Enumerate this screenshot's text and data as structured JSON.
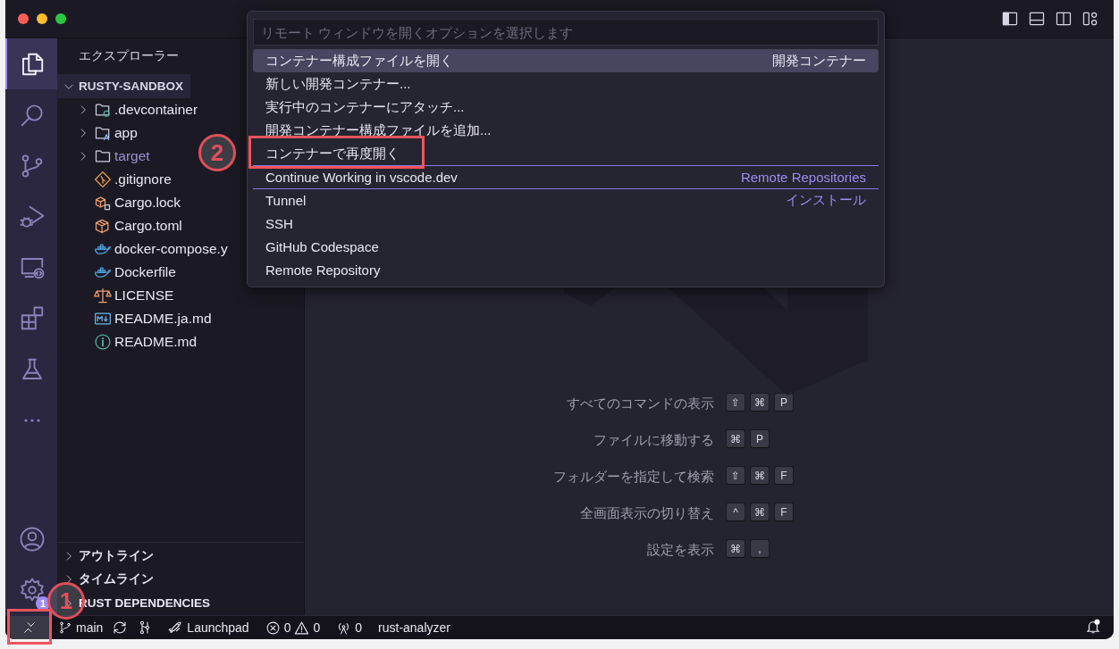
{
  "activity_bar": {
    "top": [
      {
        "kind": "files",
        "selected": true
      },
      {
        "kind": "search",
        "selected": false
      },
      {
        "kind": "source-control",
        "selected": false
      },
      {
        "kind": "run-debug",
        "selected": false
      },
      {
        "kind": "remote",
        "selected": false
      },
      {
        "kind": "extensions",
        "selected": false
      },
      {
        "kind": "testing",
        "selected": false
      },
      {
        "kind": "more",
        "selected": false
      }
    ],
    "bottom": [
      {
        "kind": "account",
        "selected": false
      },
      {
        "kind": "settings",
        "selected": false,
        "badge": "1"
      }
    ]
  },
  "sidebar": {
    "title": "エクスプローラー",
    "folder": {
      "label": "RUSTY-SANDBOX",
      "expanded": true,
      "children": [
        {
          "label": ".devcontainer",
          "kind": "devcontainer",
          "expanded": false,
          "ignored": false
        },
        {
          "label": "app",
          "kind": "app",
          "expanded": false,
          "ignored": false
        },
        {
          "label": "target",
          "kind": "folder",
          "expanded": false,
          "ignored": true
        },
        {
          "label": ".gitignore",
          "kind": "git",
          "ignored": false
        },
        {
          "label": "Cargo.lock",
          "kind": "cargo-lock",
          "ignored": false
        },
        {
          "label": "Cargo.toml",
          "kind": "cargo",
          "ignored": false
        },
        {
          "label": "docker-compose.y",
          "kind": "docker",
          "ignored": false
        },
        {
          "label": "Dockerfile",
          "kind": "docker",
          "ignored": false
        },
        {
          "label": "LICENSE",
          "kind": "license",
          "ignored": false
        },
        {
          "label": "README.ja.md",
          "kind": "markdown",
          "ignored": false
        },
        {
          "label": "README.md",
          "kind": "info",
          "ignored": false
        }
      ]
    },
    "sections": [
      {
        "label": "アウトライン",
        "expanded": false
      },
      {
        "label": "タイムライン",
        "expanded": false
      },
      {
        "label": "RUST DEPENDENCIES",
        "expanded": false
      }
    ]
  },
  "quick_pick": {
    "placeholder": "リモート ウィンドウを開くオプションを選択します",
    "items": [
      {
        "label": "コンテナー構成ファイルを開く",
        "group_label": "開発コンテナー",
        "selected": true,
        "separator": false
      },
      {
        "label": "新しい開発コンテナー...",
        "selected": false,
        "separator": false
      },
      {
        "label": "実行中のコンテナーにアタッチ...",
        "selected": false,
        "separator": false
      },
      {
        "label": "開発コンテナー構成ファイルを追加...",
        "selected": false,
        "separator": false
      },
      {
        "label": "コンテナーで再度開く",
        "selected": false,
        "separator": false
      },
      {
        "label": "Continue Working in vscode.dev",
        "group_label": "Remote Repositories",
        "selected": false,
        "separator": true
      },
      {
        "label": "Tunnel",
        "group_label": "インストール",
        "selected": false,
        "separator": true
      },
      {
        "label": "SSH",
        "selected": false,
        "separator": false
      },
      {
        "label": "GitHub Codespace",
        "selected": false,
        "separator": false
      },
      {
        "label": "Remote Repository",
        "selected": false,
        "separator": false
      }
    ]
  },
  "editor": {
    "shortcuts": [
      {
        "label": "すべてのコマンドの表示",
        "keys": [
          "⇧",
          "⌘",
          "P"
        ]
      },
      {
        "label": "ファイルに移動する",
        "keys": [
          "⌘",
          "P"
        ]
      },
      {
        "label": "フォルダーを指定して検索",
        "keys": [
          "⇧",
          "⌘",
          "F"
        ]
      },
      {
        "label": "全画面表示の切り替え",
        "keys": [
          "^",
          "⌘",
          "F"
        ]
      },
      {
        "label": "設定を表示",
        "keys": [
          "⌘",
          ","
        ]
      }
    ]
  },
  "status_bar": {
    "branch": "main",
    "launchpad": "Launchpad",
    "errors": "0",
    "warnings": "0",
    "ports": "0",
    "language_server": "rust-analyzer",
    "notifications_unread": true
  },
  "annotations": [
    {
      "label": "2"
    },
    {
      "label": "1"
    }
  ]
}
